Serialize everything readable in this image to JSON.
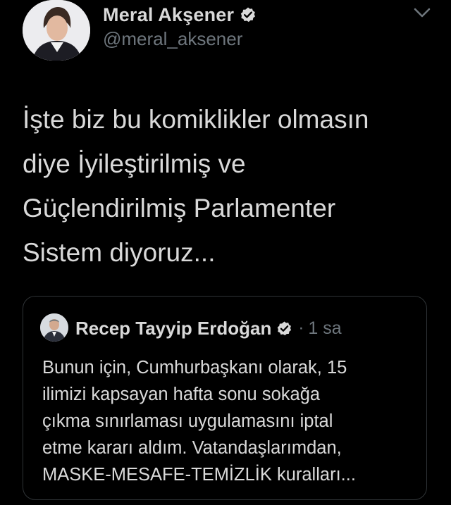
{
  "tweet": {
    "author": {
      "display_name": "Meral Akşener",
      "handle": "@meral_aksener",
      "verified": true
    },
    "text": "İşte biz bu komiklikler olmasın\ndiye İyileştirilmiş ve\nGüçlendirilmiş Parlamenter\nSistem diyoruz...",
    "quoted": {
      "author": {
        "display_name": "Recep Tayyip Erdoğan",
        "verified": true
      },
      "separator": "·",
      "time": "1 sa",
      "text": "Bunun için, Cumhurbaşkanı olarak, 15\nilimizi kapsayan hafta sonu sokağa\nçıkma sınırlaması uygulamasını iptal\netme kararı aldım. Vatandaşlarımdan,\nMASKE-MESAFE-TEMİZLİK kuralları..."
    }
  },
  "icons": {
    "verified": "verified-badge-icon",
    "more": "chevron-down-icon"
  },
  "colors": {
    "background": "#000000",
    "primary_text": "#d9d9d9",
    "secondary_text": "#6e767d",
    "border": "#2f3336"
  }
}
